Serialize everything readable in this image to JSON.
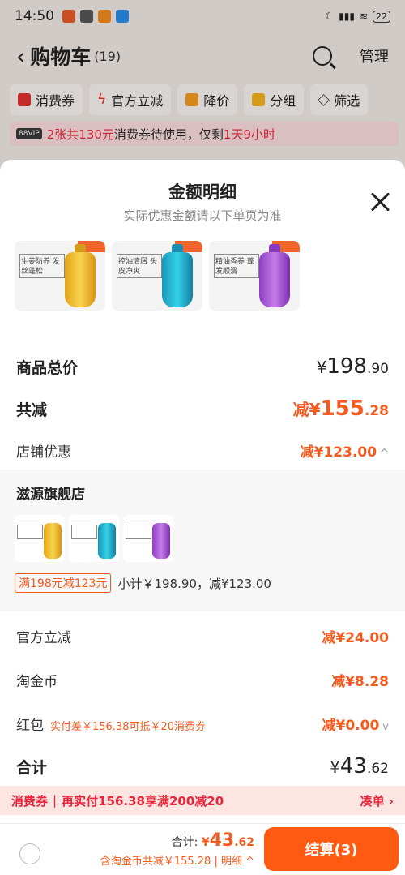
{
  "status": {
    "time": "14:50",
    "battery": "22"
  },
  "cart": {
    "title": "购物车",
    "count": "(19)",
    "manage": "管理",
    "filters": [
      "消费券",
      "官方立减",
      "降价",
      "分组",
      "筛选"
    ],
    "banner": {
      "vip": "88VIP",
      "highlight": "2张共130元",
      "text": "消费券待使用，仅剩",
      "time": "1天9小时"
    }
  },
  "sheet": {
    "title": "金额明细",
    "subtitle": "实际优惠金额请以下单页为准",
    "products": [
      {
        "label": "生姜防养 发丝蓬松"
      },
      {
        "label": "控油清屑 头皮净爽"
      },
      {
        "label": "精油香养 蓬发顺滑"
      }
    ],
    "total_price": {
      "label": "商品总价",
      "currency": "¥",
      "int": "198",
      "dec": ".90"
    },
    "total_reduce": {
      "label": "共减",
      "prefix": "减¥",
      "int": "155",
      "dec": ".28"
    },
    "shop_discount": {
      "label": "店铺优惠",
      "prefix": "减¥",
      "int": "123",
      "dec": ".00"
    },
    "shop": {
      "name": "滋源旗舰店",
      "promo_tag": "满198元减123元",
      "subtotal": "小计￥198.90，减¥123.00"
    },
    "official": {
      "label": "官方立减",
      "prefix": "减¥",
      "int": "24",
      "dec": ".00"
    },
    "taojinbi": {
      "label": "淘金币",
      "prefix": "减¥",
      "int": "8",
      "dec": ".28"
    },
    "hongbao": {
      "label": "红包",
      "note": "实付差￥156.38可抵￥20消费券",
      "prefix": "减¥",
      "int": "0",
      "dec": ".00"
    },
    "sum": {
      "label": "合计",
      "currency": "¥",
      "int": "43",
      "dec": ".62"
    }
  },
  "coupon_bar": {
    "tag": "消费券",
    "text": "再实付156.38享满200减20",
    "action": "凑单 ›"
  },
  "bottom": {
    "total_label": "合计:",
    "total_currency": "¥",
    "total_int": "43",
    "total_dec": ".62",
    "sub": "含淘金币共减￥155.28 | 明细",
    "checkout": "结算(3)"
  }
}
